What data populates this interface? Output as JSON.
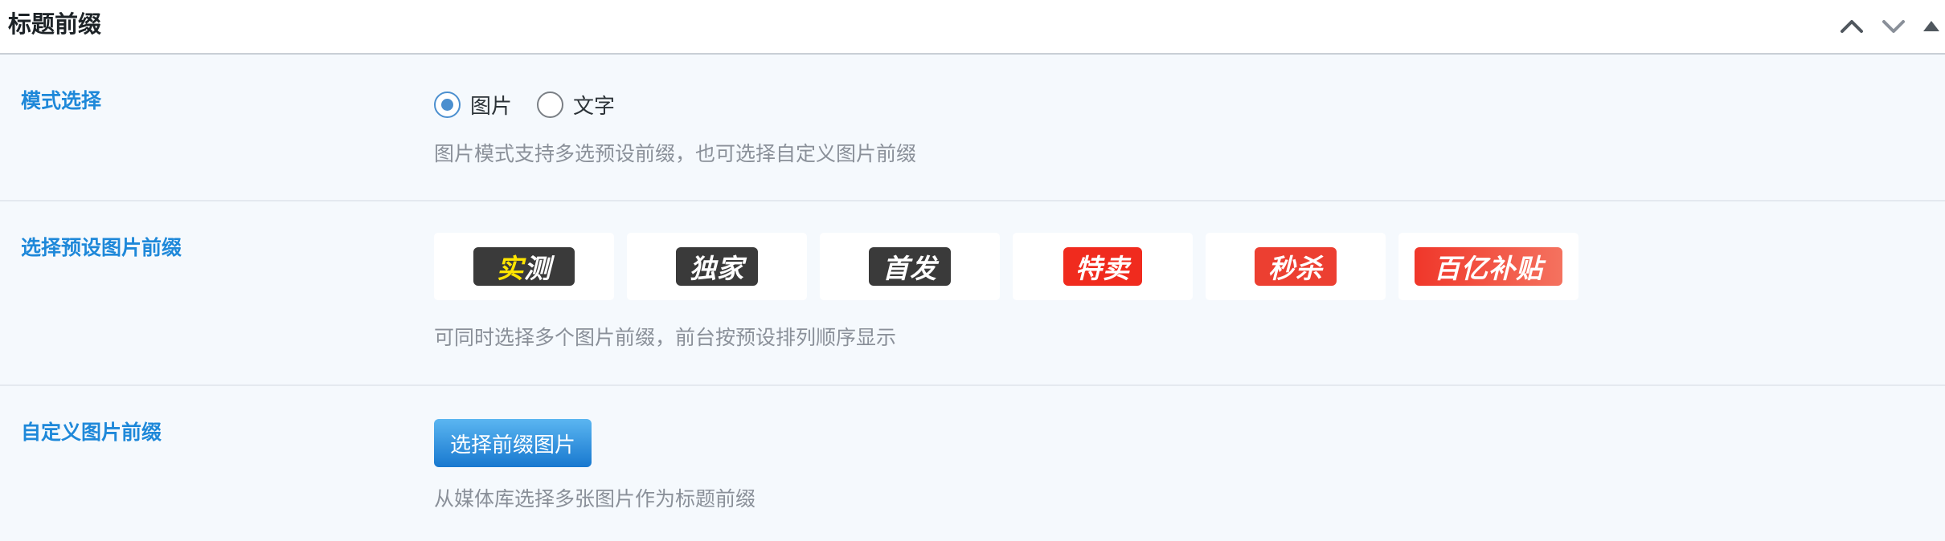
{
  "panel": {
    "title": "标题前缀",
    "icons": [
      "chevron-up-icon",
      "chevron-down-icon",
      "triangle-up-icon"
    ]
  },
  "mode": {
    "label": "模式选择",
    "options": [
      {
        "label": "图片",
        "checked": true
      },
      {
        "label": "文字",
        "checked": false
      }
    ],
    "description": "图片模式支持多选预设前缀，也可选择自定义图片前缀"
  },
  "presets": {
    "label": "选择预设图片前缀",
    "items": [
      {
        "text_a": "实",
        "text_b": "测",
        "color": "#3a3a3a",
        "accent": "#ffe500"
      },
      {
        "text_a": "独家",
        "text_b": "",
        "color": "#3a3a3a"
      },
      {
        "text_a": "首发",
        "text_b": "",
        "color": "#3a3a3a"
      },
      {
        "text_a": "特卖",
        "text_b": "",
        "color": "#f02b1e"
      },
      {
        "text_a": "秒杀",
        "text_b": "",
        "color": "#ec3f31"
      },
      {
        "text_a": "百亿补贴",
        "text_b": "",
        "color": "#f0372a"
      }
    ],
    "description": "可同时选择多个图片前缀，前台按预设排列顺序显示"
  },
  "custom": {
    "label": "自定义图片前缀",
    "button_label": "选择前缀图片",
    "description": "从媒体库选择多张图片作为标题前缀"
  }
}
